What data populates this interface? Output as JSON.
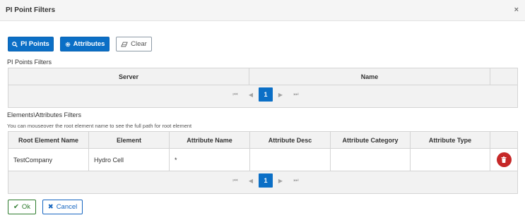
{
  "dialog": {
    "title": "PI Point Filters",
    "close_glyph": "×"
  },
  "toolbar": {
    "pi_points_label": "PI Points",
    "attributes_label": "Attributes",
    "clear_label": "Clear"
  },
  "pi_points_section": {
    "label": "PI Points Filters",
    "columns": [
      "Server",
      "Name",
      ""
    ],
    "pager": {
      "current_page": "1"
    }
  },
  "elements_section": {
    "label": "Elements\\Attributes Filters",
    "hint": "You can mouseover the root element name to see the full path for root element",
    "columns": [
      "Root Element Name",
      "Element",
      "Attribute Name",
      "Attribute Desc",
      "Attribute Category",
      "Attribute Type",
      ""
    ],
    "rows": [
      {
        "root_element_name": "TestCompany",
        "element": "Hydro Cell",
        "attribute_name": "*",
        "attribute_desc": "",
        "attribute_category": "",
        "attribute_type": ""
      }
    ],
    "pager": {
      "current_page": "1"
    }
  },
  "footer": {
    "ok_label": "Ok",
    "cancel_label": "Cancel"
  },
  "colors": {
    "primary": "#0b6fc6",
    "delete": "#c62828",
    "ok": "#2c7a2c",
    "cancel": "#1565c0"
  }
}
